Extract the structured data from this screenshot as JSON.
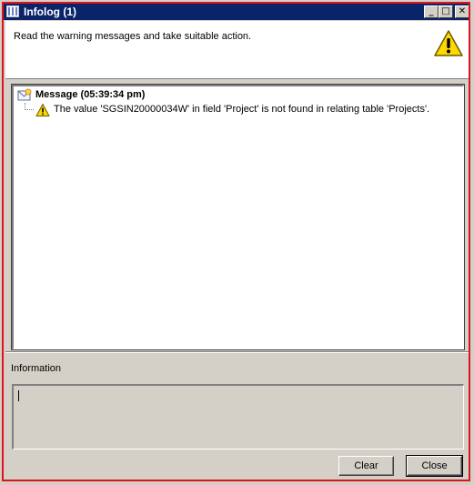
{
  "window": {
    "title": "Infolog (1)",
    "title_bar_color": "#0a246a",
    "frame_highlight_color": "#e0131c"
  },
  "titlebar_buttons": {
    "minimize": "_",
    "maximize": "□",
    "close": "✕"
  },
  "header": {
    "instruction": "Read the warning messages and take suitable action.",
    "icon": "warning-icon"
  },
  "tree": {
    "message": {
      "label": "Message (05:39:34 pm)",
      "icon": "message-icon",
      "children": [
        {
          "icon": "warning-icon",
          "text": "The value 'SGSIN20000034W' in field 'Project' is not found in relating table 'Projects'."
        }
      ]
    }
  },
  "information": {
    "label": "Information",
    "value": ""
  },
  "buttons": {
    "clear": "Clear",
    "close": "Close"
  }
}
